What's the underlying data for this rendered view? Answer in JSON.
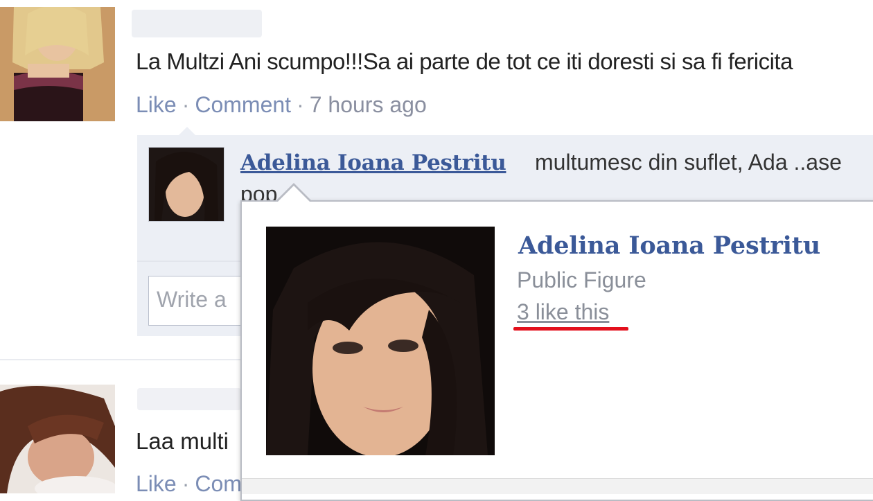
{
  "post1": {
    "text": "La Multzi Ani scumpo!!!Sa ai parte de tot ce iti doresti si sa fi fericita",
    "like": "Like",
    "comment": "Comment",
    "time": "7 hours ago",
    "separator": "·"
  },
  "comment": {
    "author": "Adelina Ioana Pestritu",
    "text": "multumesc din suflet, Ada ..ase",
    "text_line2": "pop",
    "write_placeholder": "Write a"
  },
  "post2": {
    "text": "Laa multi",
    "like": "Like",
    "comment": "Com",
    "separator": "·"
  },
  "hovercard": {
    "name": "Adelina Ioana Pestritu",
    "category": "Public Figure",
    "likes": "3 like this"
  },
  "colors": {
    "link": "#3b5998",
    "muted_link": "#7b8db5",
    "highlight": "#e3101c"
  }
}
